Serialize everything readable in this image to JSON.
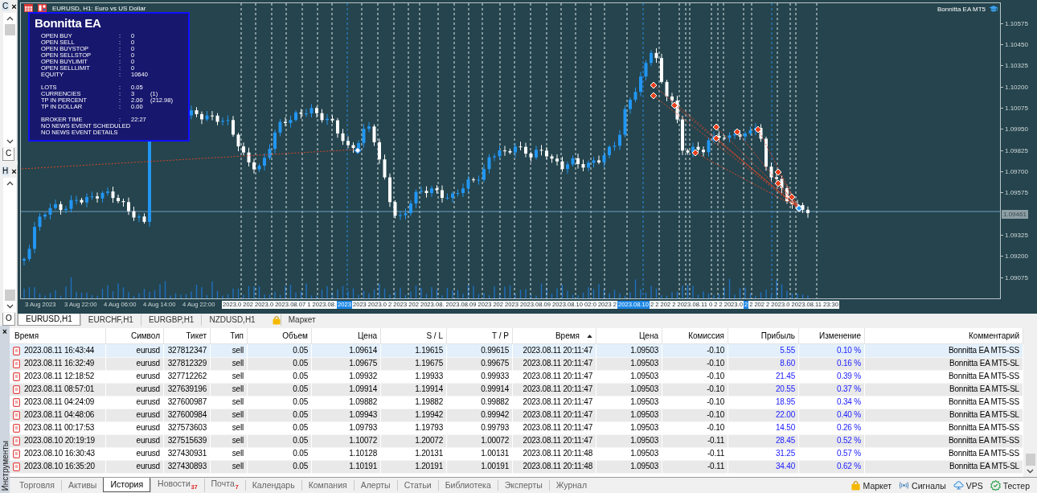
{
  "navigator_panels": [
    {
      "title": "C",
      "close": "×",
      "tab": "C"
    },
    {
      "title": "H",
      "close": "×",
      "tab": "O"
    }
  ],
  "chart": {
    "title": "EURUSD, H1:  Euro vs US Dollar",
    "expert": "Bonnitta EA MT5",
    "price_axis": [
      {
        "label": "1.10575",
        "kind": "tick"
      },
      {
        "label": "1.10450",
        "kind": "tick"
      },
      {
        "label": "1.10325",
        "kind": "tick"
      },
      {
        "label": "1.10200",
        "kind": "tick"
      },
      {
        "label": "1.10075",
        "kind": "tick"
      },
      {
        "label": "1.09950",
        "kind": "tick"
      },
      {
        "label": "1.09825",
        "kind": "tick"
      },
      {
        "label": "1.09700",
        "kind": "tick"
      },
      {
        "label": "1.09575",
        "kind": "tick"
      },
      {
        "label": "1.09461",
        "kind": "current"
      },
      {
        "label": "1.09325",
        "kind": "tick"
      },
      {
        "label": "1.09200",
        "kind": "tick"
      },
      {
        "label": "1.09075",
        "kind": "tick"
      }
    ],
    "time_axis": [
      {
        "label": "3 Aug 2023",
        "kind": "tick",
        "highlighted": false
      },
      {
        "label": "3 Aug 22:00",
        "kind": "tick",
        "highlighted": false
      },
      {
        "label": "4 Aug 06:00",
        "kind": "tick",
        "highlighted": false
      },
      {
        "label": "4 Aug 14:00",
        "kind": "tick",
        "highlighted": false
      },
      {
        "label": "4 Aug 22:00",
        "kind": "tick",
        "highlighted": false
      },
      {
        "label": "2023.0",
        "kind": "line",
        "highlighted": false
      },
      {
        "label": "202",
        "kind": "line",
        "highlighted": false
      },
      {
        "label": "2023.0",
        "kind": "line",
        "highlighted": false
      },
      {
        "label": "2023.08.07 1",
        "kind": "line",
        "highlighted": false
      },
      {
        "label": "2023.08.",
        "kind": "line",
        "highlighted": false
      },
      {
        "label": "2023",
        "kind": "line",
        "highlighted": true
      },
      {
        "label": "2023",
        "kind": "line",
        "highlighted": false
      },
      {
        "label": "2023.0",
        "kind": "line",
        "highlighted": false
      },
      {
        "label": "2",
        "kind": "line",
        "highlighted": false
      },
      {
        "label": "2023",
        "kind": "line",
        "highlighted": false
      },
      {
        "label": "202",
        "kind": "line",
        "highlighted": false
      },
      {
        "label": "2023.08.",
        "kind": "line",
        "highlighted": false
      },
      {
        "label": "2023.08.09",
        "kind": "line",
        "highlighted": false
      },
      {
        "label": "2023",
        "kind": "line",
        "highlighted": false
      },
      {
        "label": "202",
        "kind": "line",
        "highlighted": false
      },
      {
        "label": "2023",
        "kind": "line",
        "highlighted": false
      },
      {
        "label": "2023.08.09",
        "kind": "line",
        "highlighted": false
      },
      {
        "label": "2023.08.10 02:0",
        "kind": "line",
        "highlighted": false
      },
      {
        "label": "2023",
        "kind": "line",
        "highlighted": false
      },
      {
        "label": "2",
        "kind": "line",
        "highlighted": false
      },
      {
        "label": "2023.08.10",
        "kind": "line",
        "highlighted": true
      },
      {
        "label": "2",
        "kind": "line",
        "highlighted": false
      },
      {
        "label": "2",
        "kind": "line",
        "highlighted": false
      },
      {
        "label": "202",
        "kind": "line",
        "highlighted": false
      },
      {
        "label": "2",
        "kind": "line",
        "highlighted": false
      },
      {
        "label": "2023.08.11 0",
        "kind": "line",
        "highlighted": false
      },
      {
        "label": "2",
        "kind": "line",
        "highlighted": false
      },
      {
        "label": "2",
        "kind": "line",
        "highlighted": false
      },
      {
        "label": "2023.0",
        "kind": "line",
        "highlighted": false
      },
      {
        "label": "2",
        "kind": "line",
        "highlighted": true
      },
      {
        "label": "2",
        "kind": "line",
        "highlighted": false
      },
      {
        "label": "202",
        "kind": "line",
        "highlighted": false
      },
      {
        "label": "2",
        "kind": "line",
        "highlighted": false
      },
      {
        "label": "2023.0",
        "kind": "line",
        "highlighted": false
      },
      {
        "label": "2023.08.11 23:30",
        "kind": "line",
        "highlighted": false
      }
    ]
  },
  "info_panel": {
    "title": "Bonnitta EA",
    "groups": [
      {
        "rows": [
          {
            "label": "OPEN BUY",
            "sep": ":",
            "value": "0"
          },
          {
            "label": "OPEN SELL",
            "sep": ":",
            "value": "0"
          },
          {
            "label": "OPEN BUYSTOP",
            "sep": ":",
            "value": "0"
          },
          {
            "label": "OPEN SELLSTOP",
            "sep": ":",
            "value": "0"
          },
          {
            "label": "OPEN BUYLIMIT",
            "sep": ":",
            "value": "0"
          },
          {
            "label": "OPEN SELLLIMIT",
            "sep": ":",
            "value": "0"
          },
          {
            "label": "EQUITY",
            "sep": ":",
            "value": "10640"
          }
        ]
      },
      {
        "rows": [
          {
            "label": "LOTS",
            "sep": ":",
            "value": "0.05"
          },
          {
            "label": "CURRENCIES",
            "sep": ":",
            "value": "3",
            "note": "(1)"
          },
          {
            "label": "TP IN PERCENT",
            "sep": ":",
            "value": "2.00",
            "note": "(212.98)"
          },
          {
            "label": "TP IN DOLLAR",
            "sep": ":",
            "value": "0.00"
          }
        ]
      },
      {
        "rows": [
          {
            "label": "BROKER TIME",
            "sep": ":",
            "value": "22:27"
          },
          {
            "label": "NO NEWS EVENT SCHEDULED"
          },
          {
            "label": "NO NEWS EVENT DETAILS"
          }
        ]
      }
    ]
  },
  "chart_tabs": [
    {
      "label": "EURUSD,H1",
      "selected": true
    },
    {
      "label": "EURCHF,H1",
      "selected": false
    },
    {
      "label": "EURGBP,H1",
      "selected": false
    },
    {
      "label": "NZDUSD,H1",
      "selected": false
    }
  ],
  "market_tab": "Маркет",
  "toolbox": {
    "title": "Инструменты",
    "close": "×"
  },
  "table": {
    "columns": [
      {
        "label": "Время",
        "kind": "time",
        "sorted": false
      },
      {
        "label": "Символ",
        "kind": "text",
        "sorted": false
      },
      {
        "label": "Тикет",
        "kind": "text",
        "sorted": false
      },
      {
        "label": "Тип",
        "kind": "text",
        "sorted": false
      },
      {
        "label": "Объем",
        "kind": "text",
        "sorted": false
      },
      {
        "label": "Цена",
        "kind": "text",
        "sorted": false
      },
      {
        "label": "S / L",
        "kind": "text",
        "sorted": false
      },
      {
        "label": "T / P",
        "kind": "text",
        "sorted": false
      },
      {
        "label": "Время",
        "kind": "text",
        "sorted": true
      },
      {
        "label": "Цена",
        "kind": "text",
        "sorted": false
      },
      {
        "label": "Комиссия",
        "kind": "text",
        "sorted": false
      },
      {
        "label": "Прибыль",
        "kind": "profit",
        "sorted": false
      },
      {
        "label": "Изменение",
        "kind": "profit",
        "sorted": false
      },
      {
        "label": "Комментарий",
        "kind": "text",
        "sorted": false
      }
    ],
    "rows": [
      {
        "selected": true,
        "cells": [
          "2023.08.11 16:43:44",
          "eurusd",
          "327812347",
          "sell",
          "0.05",
          "1.09614",
          "1.19615",
          "0.99615",
          "2023.08.11 20:11:47",
          "1.09503",
          "-0.10",
          "5.55",
          "0.10 %",
          "Bonnitta EA MT5-SS"
        ]
      },
      {
        "selected": false,
        "cells": [
          "2023.08.11 16:32:49",
          "eurusd",
          "327812329",
          "sell",
          "0.05",
          "1.09675",
          "1.19675",
          "0.99675",
          "2023.08.11 20:11:47",
          "1.09503",
          "-0.10",
          "8.60",
          "0.16 %",
          "Bonnitta EA MT5-SL"
        ]
      },
      {
        "selected": false,
        "cells": [
          "2023.08.11 12:18:52",
          "eurusd",
          "327712262",
          "sell",
          "0.05",
          "1.09932",
          "1.19933",
          "0.99933",
          "2023.08.11 20:11:47",
          "1.09503",
          "-0.10",
          "21.45",
          "0.39 %",
          "Bonnitta EA MT5-SS"
        ]
      },
      {
        "selected": false,
        "cells": [
          "2023.08.11 08:57:01",
          "eurusd",
          "327639196",
          "sell",
          "0.05",
          "1.09914",
          "1.19914",
          "0.99914",
          "2023.08.11 20:11:47",
          "1.09503",
          "-0.10",
          "20.55",
          "0.37 %",
          "Bonnitta EA MT5-SL"
        ]
      },
      {
        "selected": false,
        "cells": [
          "2023.08.11 04:24:09",
          "eurusd",
          "327600987",
          "sell",
          "0.05",
          "1.09882",
          "1.19882",
          "0.99882",
          "2023.08.11 20:11:47",
          "1.09503",
          "-0.10",
          "18.95",
          "0.34 %",
          "Bonnitta EA MT5-SS"
        ]
      },
      {
        "selected": false,
        "cells": [
          "2023.08.11 04:48:06",
          "eurusd",
          "327600984",
          "sell",
          "0.05",
          "1.09943",
          "1.19942",
          "0.99942",
          "2023.08.11 20:11:47",
          "1.09503",
          "-0.10",
          "22.00",
          "0.40 %",
          "Bonnitta EA MT5-SL"
        ]
      },
      {
        "selected": false,
        "cells": [
          "2023.08.11 00:17:53",
          "eurusd",
          "327573603",
          "sell",
          "0.05",
          "1.09793",
          "1.19793",
          "0.99793",
          "2023.08.11 20:11:47",
          "1.09503",
          "-0.10",
          "14.50",
          "0.26 %",
          "Bonnitta EA MT5-SS"
        ]
      },
      {
        "selected": false,
        "cells": [
          "2023.08.10 20:19:19",
          "eurusd",
          "327515639",
          "sell",
          "0.05",
          "1.10072",
          "1.20072",
          "1.00072",
          "2023.08.11 20:11:47",
          "1.09503",
          "-0.11",
          "28.45",
          "0.52 %",
          "Bonnitta EA MT5-SS"
        ]
      },
      {
        "selected": false,
        "cells": [
          "2023.08.10 16:30:43",
          "eurusd",
          "327430931",
          "sell",
          "0.05",
          "1.10128",
          "1.20131",
          "1.00131",
          "2023.08.11 20:11:48",
          "1.09503",
          "-0.11",
          "31.25",
          "0.57 %",
          "Bonnitta EA MT5-SS"
        ]
      },
      {
        "selected": false,
        "cells": [
          "2023.08.10 16:35:20",
          "eurusd",
          "327430893",
          "sell",
          "0.05",
          "1.10191",
          "1.20191",
          "1.00191",
          "2023.08.11 20:11:48",
          "1.09503",
          "-0.11",
          "34.40",
          "0.62 %",
          "Bonnitta EA MT5-SL"
        ]
      }
    ]
  },
  "bottom_tabs": [
    {
      "label": "Торговля",
      "selected": false
    },
    {
      "label": "Активы",
      "selected": false
    },
    {
      "label": "История",
      "selected": true
    },
    {
      "label": "Новости",
      "badge": "37",
      "selected": false
    },
    {
      "label": "Почта",
      "badge": "7",
      "selected": false
    },
    {
      "label": "Календарь",
      "selected": false
    },
    {
      "label": "Компания",
      "selected": false
    },
    {
      "label": "Алерты",
      "selected": false
    },
    {
      "label": "Статьи",
      "selected": false
    },
    {
      "label": "Библиотека",
      "selected": false
    },
    {
      "label": "Эксперты",
      "selected": false
    },
    {
      "label": "Журнал",
      "selected": false
    }
  ],
  "services": [
    {
      "label": "Маркет",
      "kind": "market"
    },
    {
      "label": "Сигналы",
      "kind": "signals"
    },
    {
      "label": "VPS",
      "kind": "vps"
    },
    {
      "label": "Тестер",
      "kind": "tester"
    }
  ]
}
